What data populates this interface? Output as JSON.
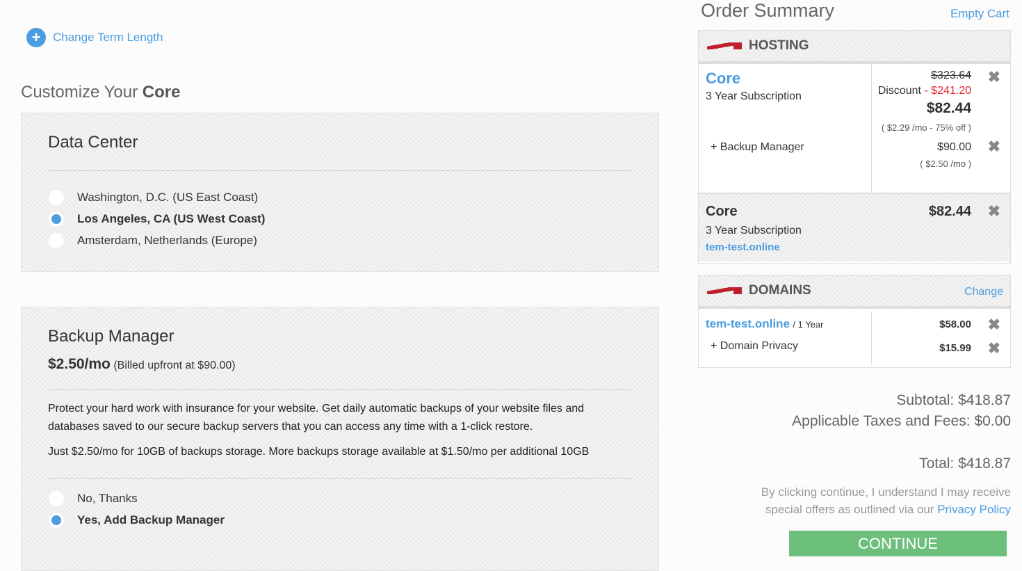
{
  "term": {
    "label": "Change Term Length",
    "icon": "gear-plus-icon"
  },
  "customize": {
    "prefix": "Customize Your ",
    "product": "Core"
  },
  "data_center": {
    "title": "Data Center",
    "options": [
      {
        "label": "Washington, D.C. (US East Coast)",
        "selected": false
      },
      {
        "label": "Los Angeles, CA (US West Coast)",
        "selected": true
      },
      {
        "label": "Amsterdam, Netherlands (Europe)",
        "selected": false
      }
    ]
  },
  "backup": {
    "title": "Backup Manager",
    "price": "$2.50/mo",
    "billed": "(Billed upfront at $90.00)",
    "desc1": "Protect your hard work with insurance for your website. Get daily automatic backups of your website files and databases saved to our secure backup servers that you can access any time with a 1-click restore.",
    "desc2": "Just $2.50/mo for 10GB of backups storage. More backups storage available at $1.50/mo per additional 10GB",
    "options": [
      {
        "label": "No, Thanks",
        "selected": false
      },
      {
        "label": "Yes, Add Backup Manager",
        "selected": true
      }
    ]
  },
  "summary": {
    "title": "Order Summary",
    "empty": "Empty Cart",
    "hosting": {
      "header": "HOSTING",
      "name": "Core",
      "term": "3 Year Subscription",
      "original": "$323.64",
      "discount_label": "Discount",
      "discount": "- $241.20",
      "price": "$82.44",
      "monthly": "( $2.29 /mo - 75% off )",
      "addon": "+ Backup Manager",
      "addon_price": "$90.00",
      "addon_monthly": "( $2.50 /mo )",
      "collapsed": {
        "name": "Core",
        "term": "3 Year Subscription",
        "domain": "tem-test.online",
        "price": "$82.44"
      }
    },
    "domains": {
      "header": "DOMAINS",
      "change": "Change",
      "name": "tem-test.online",
      "term": "/ 1 Year",
      "price": "$58.00",
      "addon": "+ Domain Privacy",
      "addon_price": "$15.99"
    },
    "subtotal": "Subtotal: $418.87",
    "taxes": "Applicable Taxes and Fees: $0.00",
    "total": "Total: $418.87",
    "fine1": "By clicking continue, I understand I may receive",
    "fine2": "special offers as outlined via our ",
    "privacy": "Privacy Policy",
    "continue": "CONTINUE"
  },
  "colors": {
    "accent": "#4a9de0",
    "discount": "#e8202f",
    "continue": "#6cc07b"
  }
}
